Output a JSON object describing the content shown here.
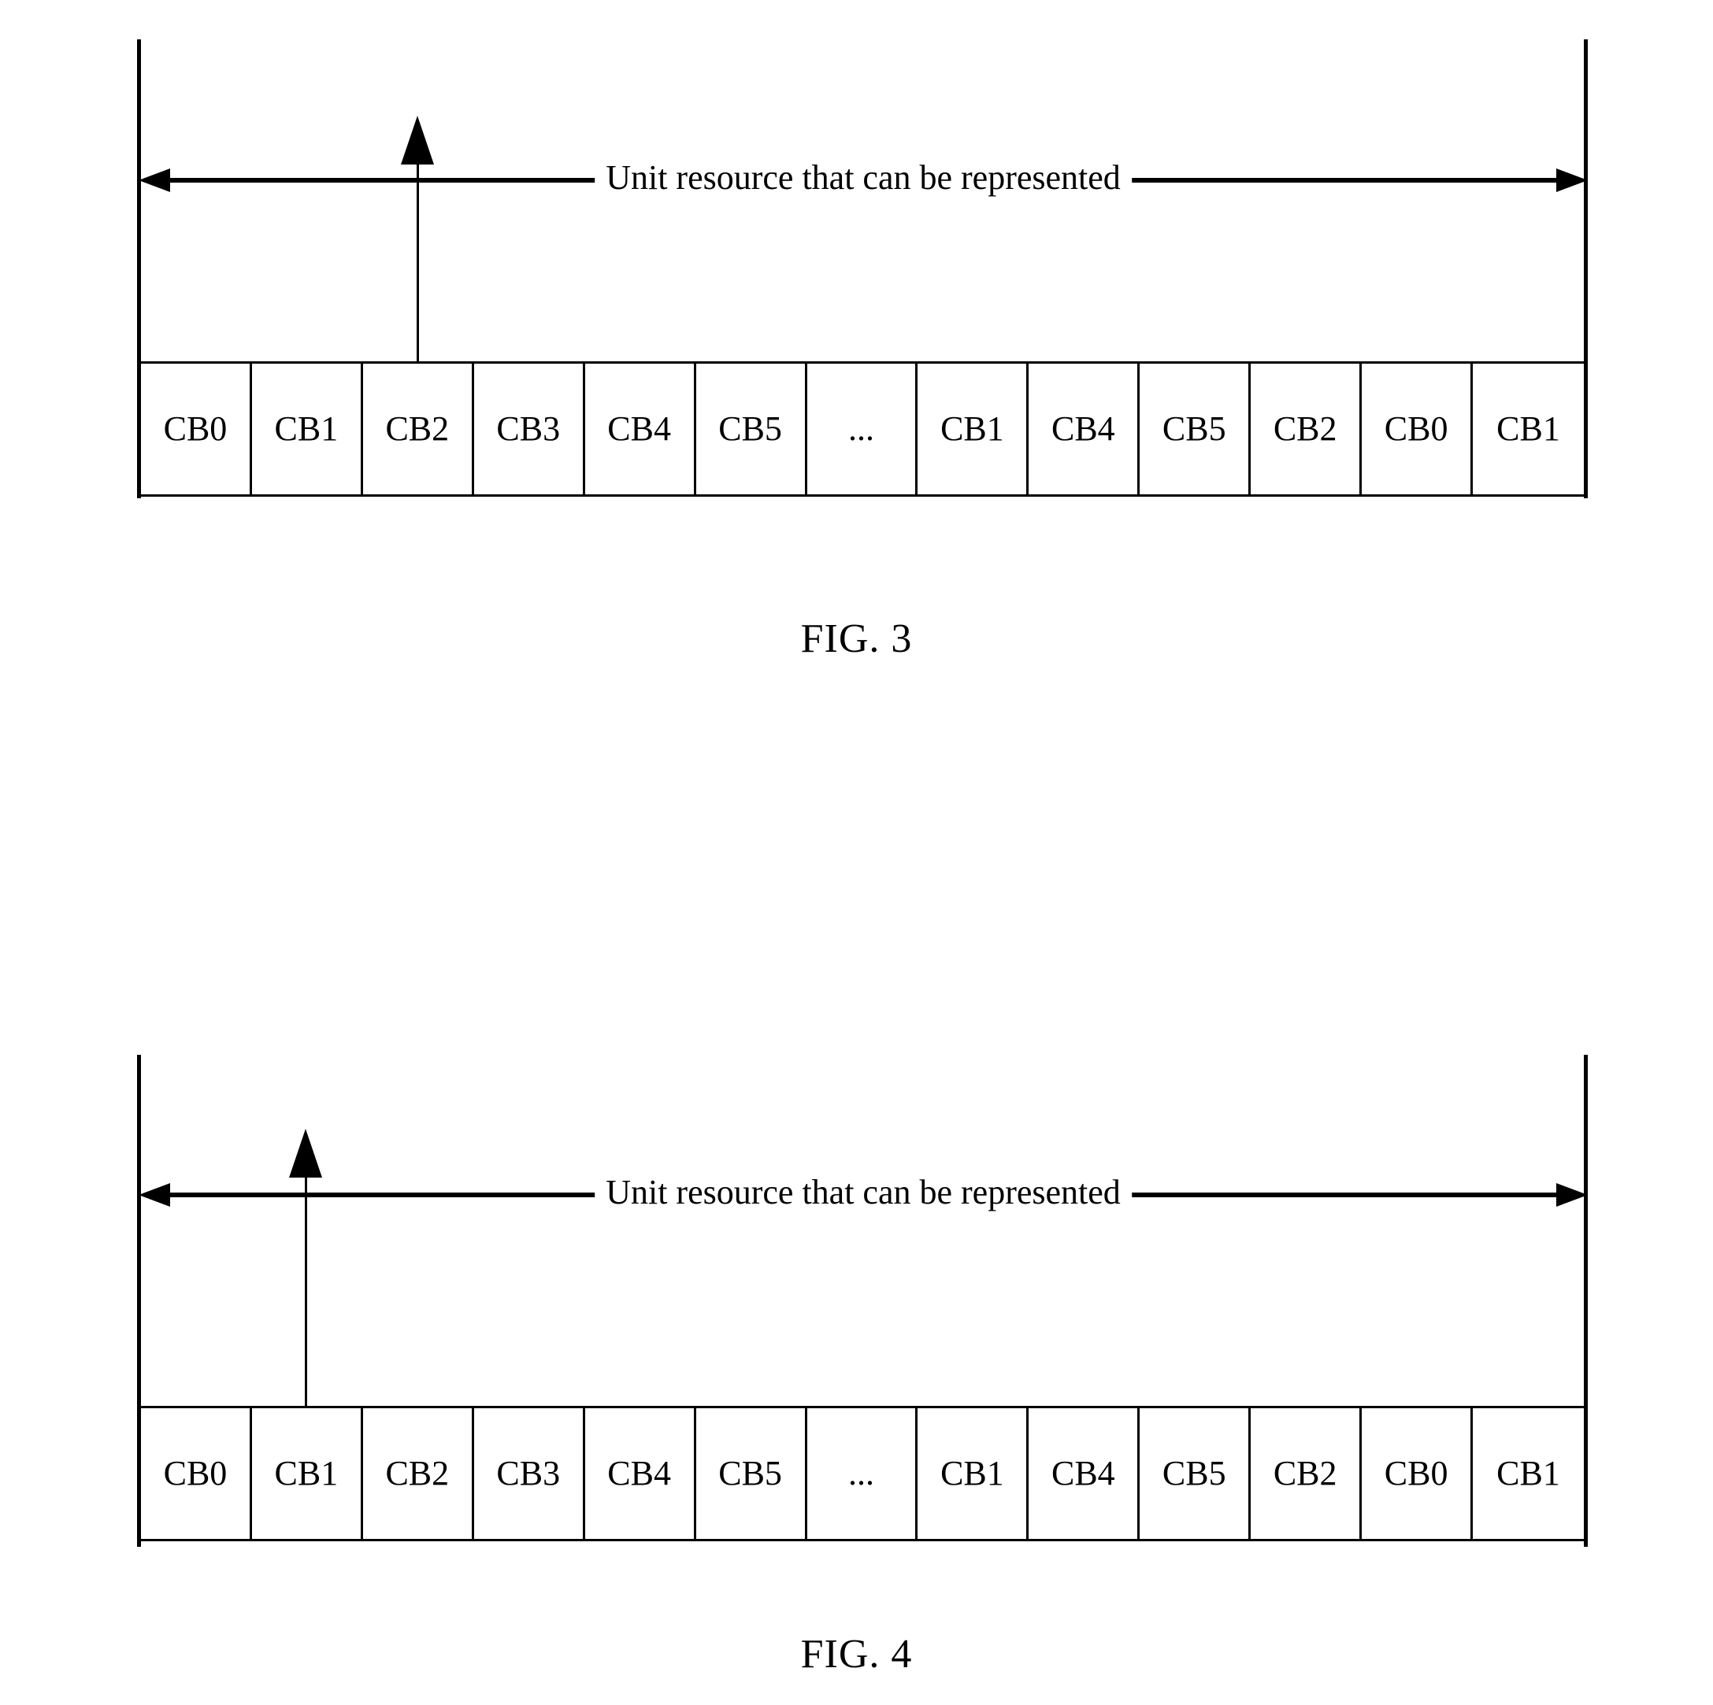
{
  "document": {
    "type": "patent-drawing-sheet",
    "background_color": "#ffffff",
    "line_color": "#000000"
  },
  "figures": [
    {
      "id": "fig3",
      "caption": "FIG. 3",
      "span_arrow_label": "Unit resource that can be represented",
      "pointer_target_index": 2,
      "pointer_target_label": "CB2",
      "cells": [
        "CB0",
        "CB1",
        "CB2",
        "CB3",
        "CB4",
        "CB5",
        "...",
        "CB1",
        "CB4",
        "CB5",
        "CB2",
        "CB0",
        "CB1"
      ]
    },
    {
      "id": "fig4",
      "caption": "FIG. 4",
      "span_arrow_label": "Unit resource that can be represented",
      "pointer_target_index": 1,
      "pointer_target_label": "CB1",
      "cells": [
        "CB0",
        "CB1",
        "CB2",
        "CB3",
        "CB4",
        "CB5",
        "...",
        "CB1",
        "CB4",
        "CB5",
        "CB2",
        "CB0",
        "CB1"
      ]
    }
  ]
}
